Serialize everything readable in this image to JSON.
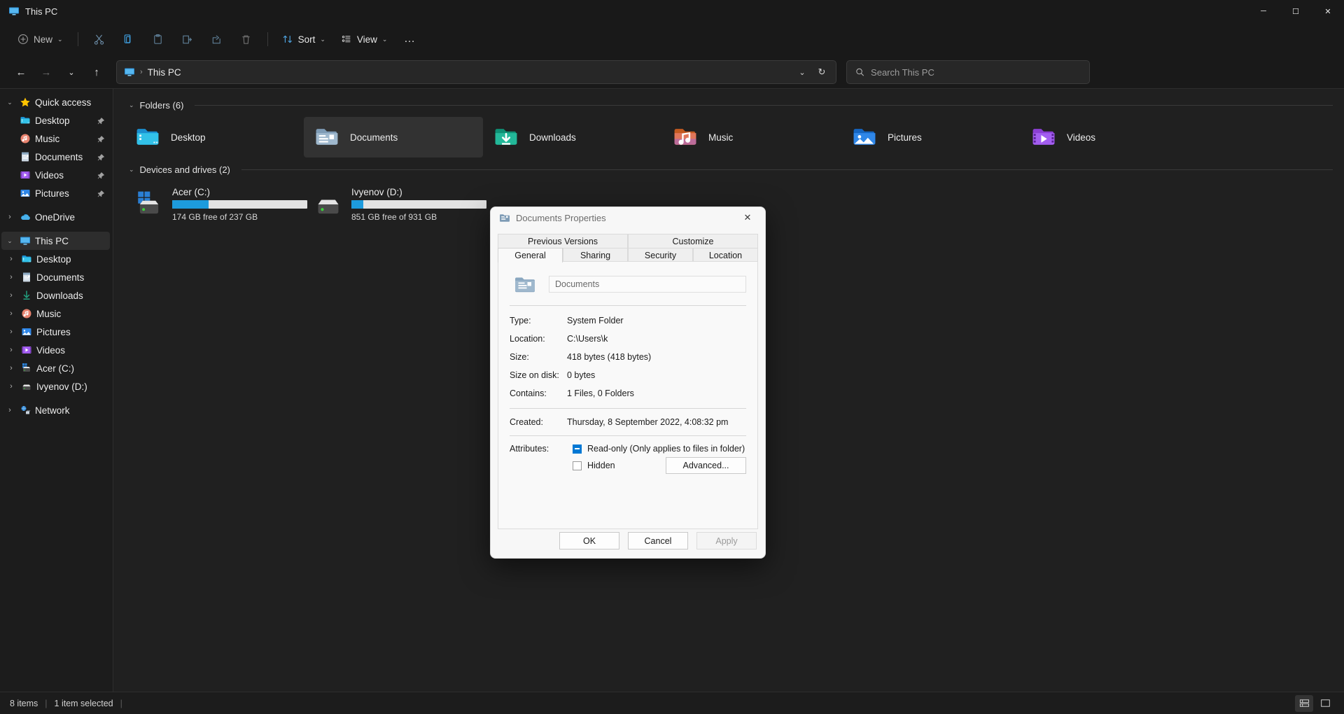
{
  "window": {
    "title": "This PC",
    "title_icon": "this-pc-icon",
    "minimize": "─",
    "maximize": "☐",
    "close": "✕"
  },
  "toolbar": {
    "new_label": "New",
    "new_caret": "⌄",
    "cut_title": "Cut",
    "copy_title": "Copy",
    "paste_title": "Paste",
    "rename_title": "Rename",
    "share_title": "Share",
    "delete_title": "Delete",
    "sort_label": "Sort",
    "sort_caret": "⌄",
    "view_label": "View",
    "view_caret": "⌄",
    "more_label": "…"
  },
  "navbar": {
    "back": "←",
    "forward": "→",
    "recent": "⌄",
    "up": "↑",
    "breadcrumb_icon": "this-pc-icon",
    "breadcrumb": "This PC",
    "breadcrumb_sep": "›",
    "dropdown": "⌄",
    "refresh": "↻"
  },
  "search": {
    "placeholder": "Search This PC",
    "value": "",
    "icon": "search-icon"
  },
  "sidebar": {
    "items": [
      {
        "label": "Quick access",
        "icon": "star-icon",
        "level": 0,
        "twisty": "expanded",
        "pinned": false,
        "selected": false
      },
      {
        "label": "Desktop",
        "icon": "desktop-icon",
        "level": 1,
        "twisty": "none",
        "pinned": true,
        "selected": false
      },
      {
        "label": "Music",
        "icon": "music-icon",
        "level": 1,
        "twisty": "none",
        "pinned": true,
        "selected": false
      },
      {
        "label": "Documents",
        "icon": "documents-icon",
        "level": 1,
        "twisty": "none",
        "pinned": true,
        "selected": false
      },
      {
        "label": "Videos",
        "icon": "videos-icon",
        "level": 1,
        "twisty": "none",
        "pinned": true,
        "selected": false
      },
      {
        "label": "Pictures",
        "icon": "pictures-icon",
        "level": 1,
        "twisty": "none",
        "pinned": true,
        "selected": false
      },
      {
        "label": "OneDrive",
        "icon": "onedrive-icon",
        "level": 0,
        "twisty": "collapsed",
        "pinned": false,
        "selected": false
      },
      {
        "label": "This PC",
        "icon": "this-pc-icon",
        "level": 0,
        "twisty": "expanded",
        "pinned": false,
        "selected": true
      },
      {
        "label": "Desktop",
        "icon": "desktop-icon",
        "level": 2,
        "twisty": "collapsed",
        "pinned": false,
        "selected": false
      },
      {
        "label": "Documents",
        "icon": "documents-icon",
        "level": 2,
        "twisty": "collapsed",
        "pinned": false,
        "selected": false
      },
      {
        "label": "Downloads",
        "icon": "downloads-icon",
        "level": 2,
        "twisty": "collapsed",
        "pinned": false,
        "selected": false
      },
      {
        "label": "Music",
        "icon": "music-icon",
        "level": 2,
        "twisty": "collapsed",
        "pinned": false,
        "selected": false
      },
      {
        "label": "Pictures",
        "icon": "pictures-icon",
        "level": 2,
        "twisty": "collapsed",
        "pinned": false,
        "selected": false
      },
      {
        "label": "Videos",
        "icon": "videos-icon",
        "level": 2,
        "twisty": "collapsed",
        "pinned": false,
        "selected": false
      },
      {
        "label": "Acer (C:)",
        "icon": "windows-drive-icon",
        "level": 2,
        "twisty": "collapsed",
        "pinned": false,
        "selected": false
      },
      {
        "label": "Ivyenov (D:)",
        "icon": "drive-icon",
        "level": 2,
        "twisty": "collapsed",
        "pinned": false,
        "selected": false
      },
      {
        "label": "Network",
        "icon": "network-icon",
        "level": 0,
        "twisty": "collapsed",
        "pinned": false,
        "selected": false
      }
    ]
  },
  "content": {
    "folders_group": {
      "title": "Folders (6)",
      "twisty": "⌄"
    },
    "folders": [
      {
        "name": "Desktop",
        "icon": "desktop-folder-icon",
        "selected": false
      },
      {
        "name": "Documents",
        "icon": "documents-folder-icon",
        "selected": true
      },
      {
        "name": "Downloads",
        "icon": "downloads-folder-icon",
        "selected": false
      },
      {
        "name": "Music",
        "icon": "music-folder-icon",
        "selected": false
      },
      {
        "name": "Pictures",
        "icon": "pictures-folder-icon",
        "selected": false
      },
      {
        "name": "Videos",
        "icon": "videos-folder-icon",
        "selected": false
      }
    ],
    "drives_group": {
      "title": "Devices and drives (2)",
      "twisty": "⌄"
    },
    "drives": [
      {
        "name": "Acer (C:)",
        "icon": "windows-drive-icon",
        "free_text": "174 GB free of 237 GB",
        "used_percent": 27
      },
      {
        "name": "Ivyenov (D:)",
        "icon": "drive-icon",
        "free_text": "851 GB free of 931 GB",
        "used_percent": 9
      }
    ]
  },
  "statusbar": {
    "item_count": "8 items",
    "selection": "1 item selected",
    "sep": "|",
    "details_view_icon": "details-view-icon",
    "tiles_view_icon": "tiles-view-icon"
  },
  "dialog": {
    "title": "Documents Properties",
    "title_icon": "documents-folder-icon",
    "close": "✕",
    "tabs_top": [
      {
        "label": "Previous Versions",
        "active": false
      },
      {
        "label": "Customize",
        "active": false
      }
    ],
    "tabs_bottom": [
      {
        "label": "General",
        "active": true
      },
      {
        "label": "Sharing",
        "active": false
      },
      {
        "label": "Security",
        "active": false
      },
      {
        "label": "Location",
        "active": false
      }
    ],
    "folder_icon": "documents-folder-icon",
    "name_value": "Documents",
    "properties": [
      {
        "key": "Type:",
        "value": "System Folder"
      },
      {
        "key": "Location:",
        "value": "C:\\Users\\k"
      },
      {
        "key": "Size:",
        "value": "418 bytes (418 bytes)"
      },
      {
        "key": "Size on disk:",
        "value": "0 bytes"
      },
      {
        "key": "Contains:",
        "value": "1 Files, 0 Folders"
      }
    ],
    "created": {
      "key": "Created:",
      "value": "Thursday, 8 September 2022, 4:08:32 pm"
    },
    "attributes": {
      "key": "Attributes:",
      "readonly_label": "Read-only (Only applies to files in folder)",
      "readonly_state": "indeterminate",
      "hidden_label": "Hidden",
      "hidden_state": "unchecked",
      "advanced_label": "Advanced..."
    },
    "buttons": {
      "ok": "OK",
      "cancel": "Cancel",
      "apply": "Apply",
      "apply_disabled": true
    }
  }
}
